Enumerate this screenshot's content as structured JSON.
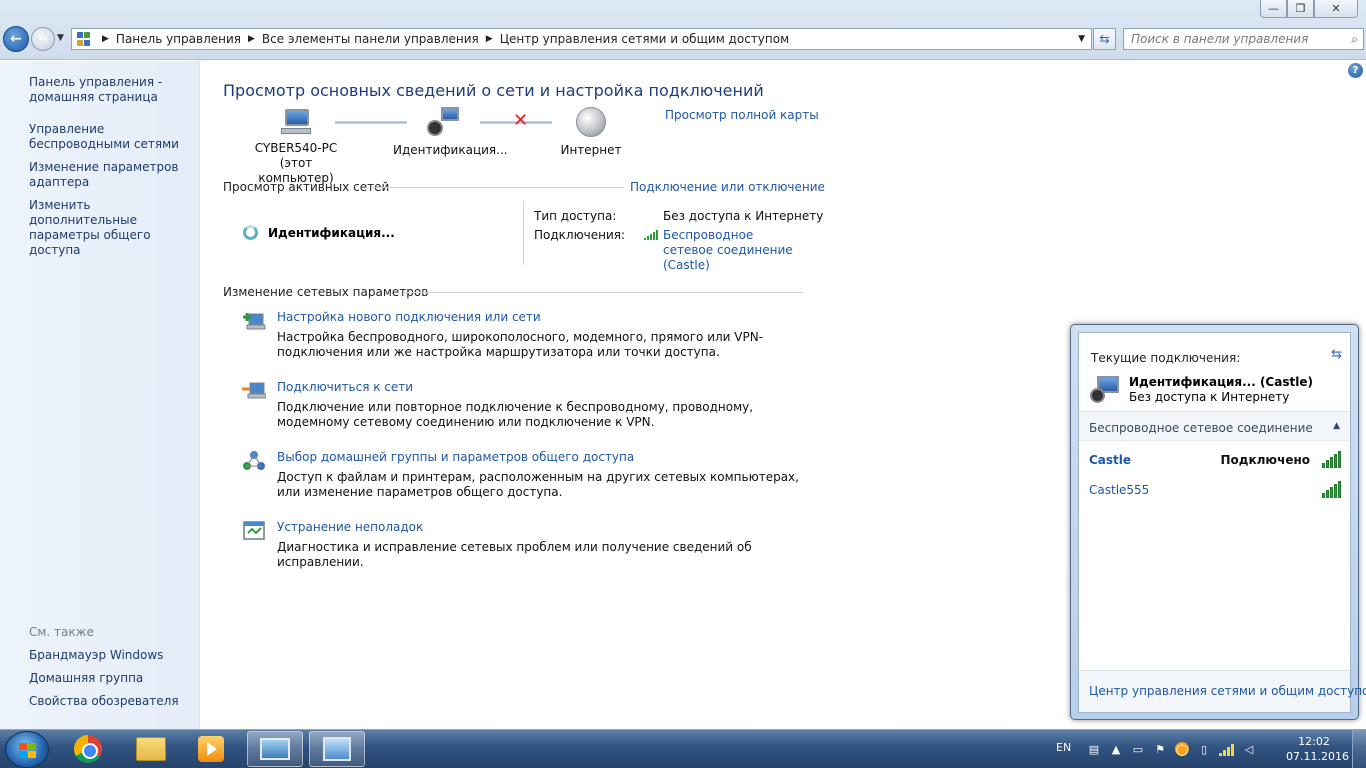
{
  "window": {
    "minimize": "—",
    "maximize": "❐",
    "close": "✕"
  },
  "address": {
    "crumbs": [
      "Панель управления",
      "Все элементы панели управления",
      "Центр управления сетями и общим доступом"
    ],
    "search_placeholder": "Поиск в панели управления"
  },
  "sidebar": {
    "links": [
      "Панель управления - домашняя страница",
      "Управление беспроводными сетями",
      "Изменение параметров адаптера",
      "Изменить дополнительные параметры общего доступа"
    ],
    "see_also_title": "См. также",
    "see_also": [
      "Брандмауэр Windows",
      "Домашняя группа",
      "Свойства обозревателя"
    ]
  },
  "main": {
    "title": "Просмотр основных сведений о сети и настройка подключений",
    "full_map_link": "Просмотр полной карты",
    "map": {
      "computer_name": "CYBER540-PC",
      "computer_sub": "(этот компьютер)",
      "network": "Идентификация...",
      "internet": "Интернет"
    },
    "active_networks": {
      "title": "Просмотр активных сетей",
      "connect_link": "Подключение или отключение",
      "network_name": "Идентификация...",
      "access_label": "Тип доступа:",
      "access_value": "Без доступа к Интернету",
      "connections_label": "Подключения:",
      "connections_value": "Беспроводное сетевое соединение (Castle)"
    },
    "change_settings": {
      "title": "Изменение сетевых параметров",
      "tasks": [
        {
          "link": "Настройка нового подключения или сети",
          "desc": "Настройка беспроводного, широкополосного, модемного, прямого или VPN-подключения или же настройка маршрутизатора или точки доступа."
        },
        {
          "link": "Подключиться к сети",
          "desc": "Подключение или повторное подключение к беспроводному, проводному, модемному сетевому соединению или подключение к VPN."
        },
        {
          "link": "Выбор домашней группы и параметров общего доступа",
          "desc": "Доступ к файлам и принтерам, расположенным на других сетевых компьютерах, или изменение параметров общего доступа."
        },
        {
          "link": "Устранение неполадок",
          "desc": "Диагностика и исправление сетевых проблем или получение сведений об исправлении."
        }
      ]
    }
  },
  "flyout": {
    "current_label": "Текущие подключения:",
    "connection_name": "Идентификация... (Castle)",
    "connection_status": "Без доступа к Интернету",
    "section_label": "Беспроводное сетевое соединение",
    "networks": [
      {
        "name": "Castle",
        "status": "Подключено"
      },
      {
        "name": "Castle555",
        "status": ""
      }
    ],
    "footer_link": "Центр управления сетями и общим доступом"
  },
  "taskbar": {
    "lang": "EN",
    "time": "12:02",
    "date": "07.11.2016"
  }
}
